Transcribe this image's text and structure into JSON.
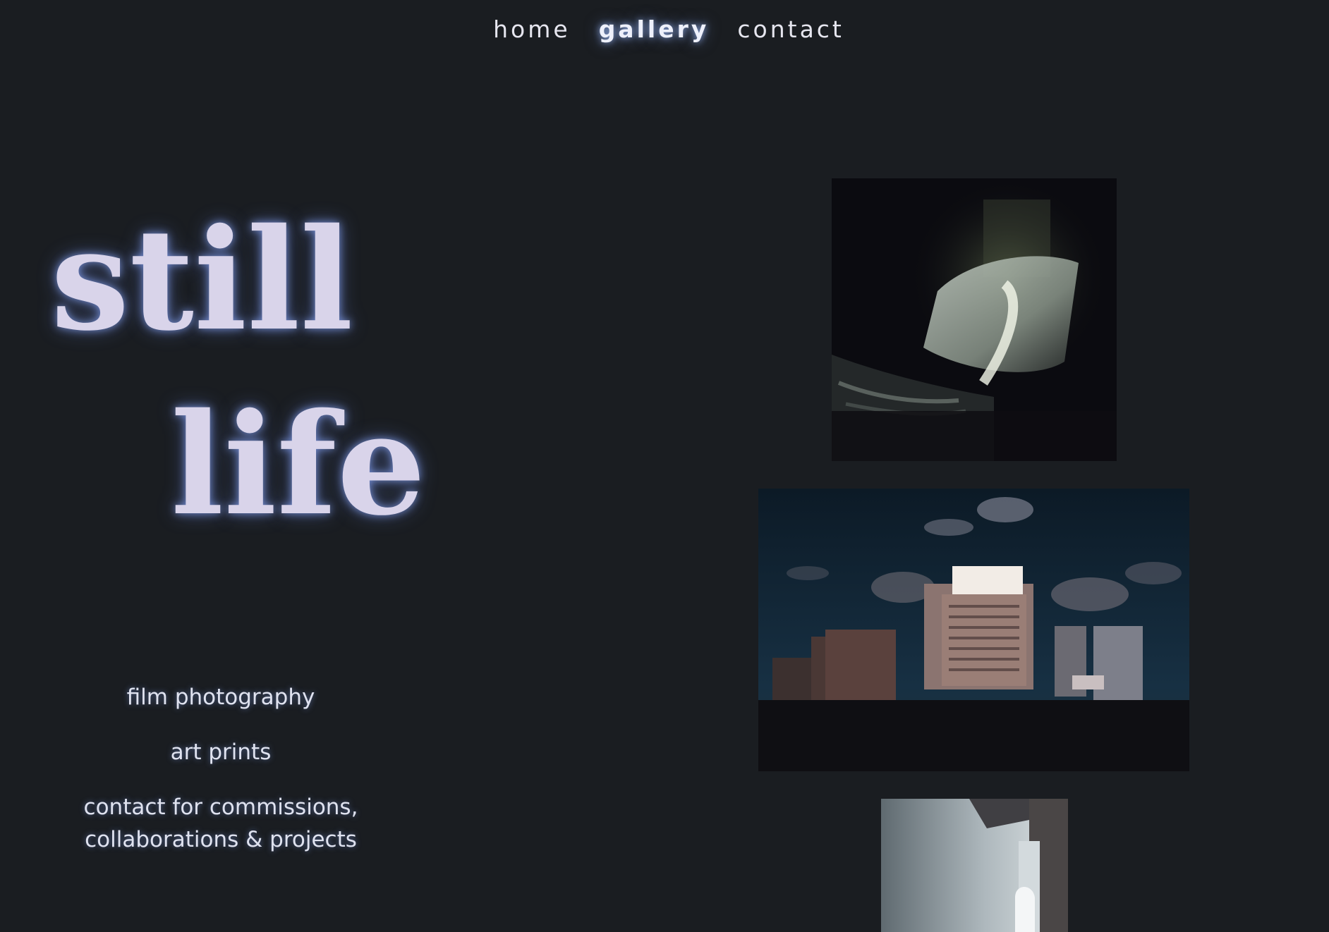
{
  "nav": {
    "items": [
      {
        "label": "home",
        "active": false
      },
      {
        "label": "gallery",
        "active": true
      },
      {
        "label": "contact",
        "active": false
      }
    ]
  },
  "hero": {
    "word1": "still",
    "word2": "life"
  },
  "taglines": {
    "line1": "film photography",
    "line2": "art prints",
    "line3a": "contact for commissions,",
    "line3b": "collaborations & projects"
  },
  "gallery": {
    "photos": [
      {
        "subject": "pillow-on-bed-in-dark-room"
      },
      {
        "subject": "city-buildings-at-sunset"
      },
      {
        "subject": "window-light-in-corridor"
      }
    ]
  },
  "colors": {
    "background": "#1a1d21",
    "glow": "#8caaff",
    "title_text": "#d9d4ea"
  }
}
